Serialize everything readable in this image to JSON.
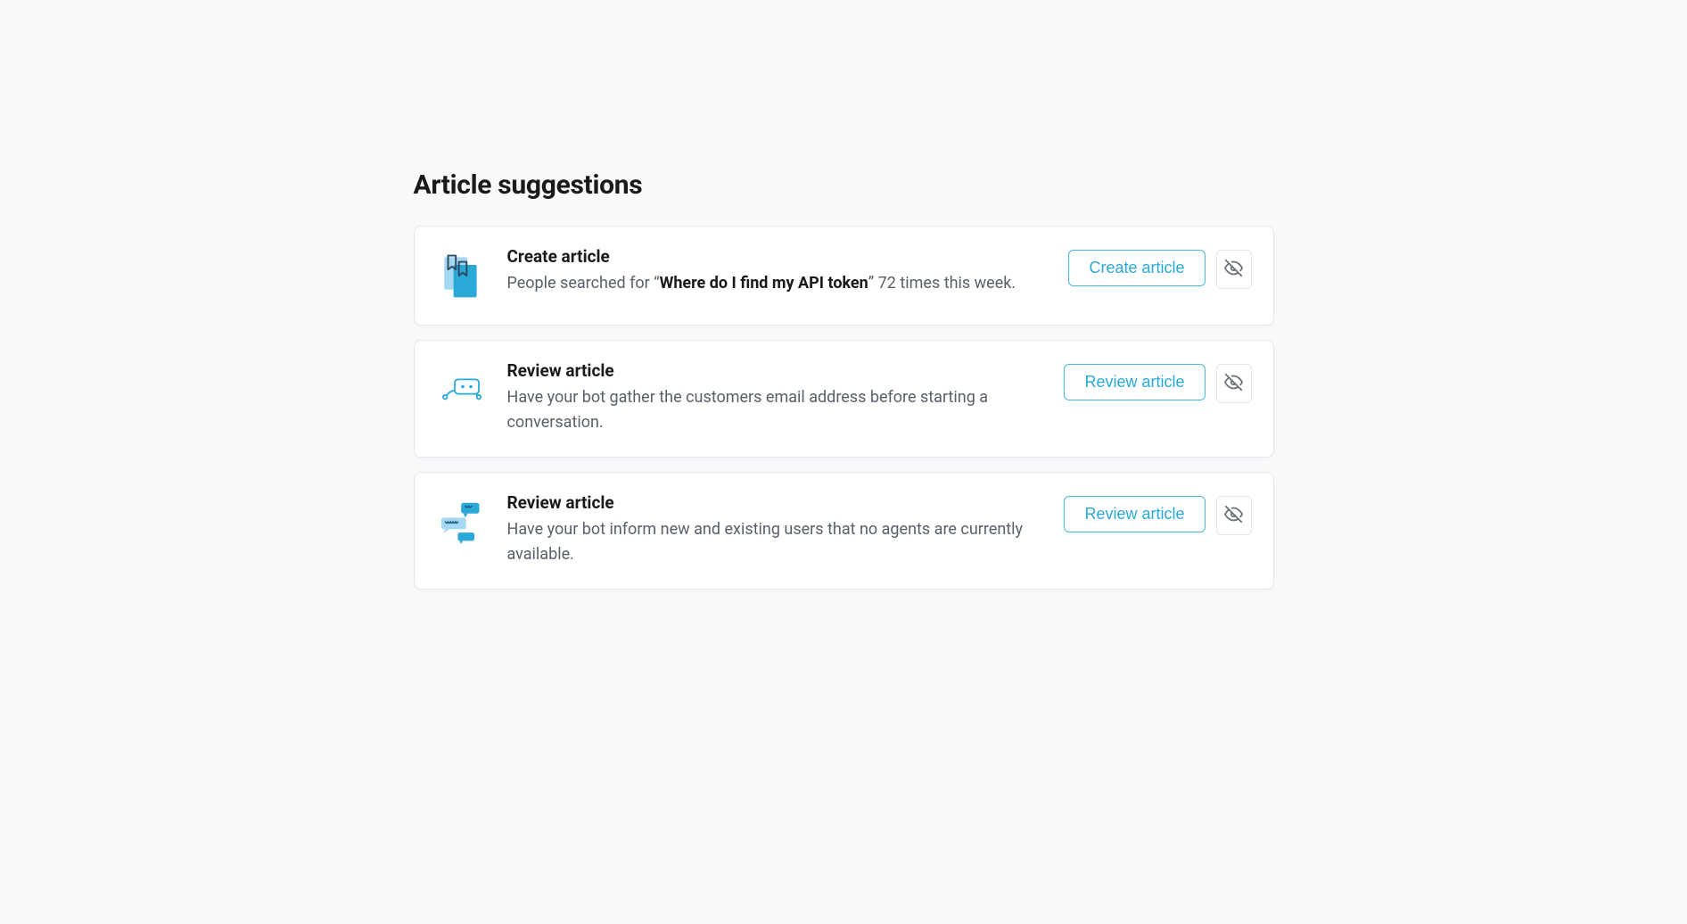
{
  "section": {
    "title": "Article suggestions"
  },
  "cards": [
    {
      "title": "Create article",
      "desc_prefix": "People searched for “",
      "desc_bold": "Where do I find my API token",
      "desc_suffix": "” 72 times this week.",
      "button_label": "Create article"
    },
    {
      "title": "Review article",
      "desc_prefix": "Have your bot gather the customers email address before starting a conversation.",
      "desc_bold": "",
      "desc_suffix": "",
      "button_label": "Review article"
    },
    {
      "title": "Review article",
      "desc_prefix": "Have your bot inform new and existing users that no agents are currently available.",
      "desc_bold": "",
      "desc_suffix": "",
      "button_label": "Review article"
    }
  ]
}
